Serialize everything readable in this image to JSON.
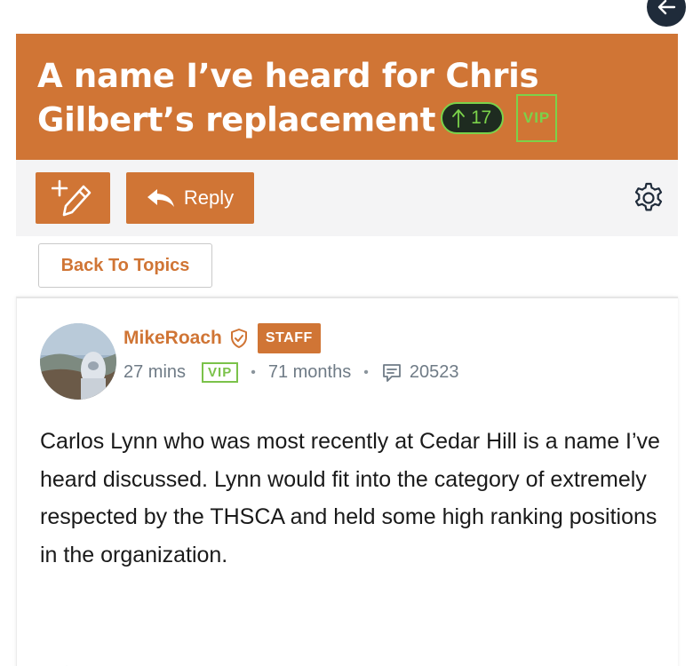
{
  "header": {
    "title": "A name I’ve heard for Chris Gilbert’s replacement",
    "vote_count": "17",
    "vip_badge": "VIP",
    "accent_color": "#d07535"
  },
  "toolbar": {
    "new_post_icon": "pencil-plus-icon",
    "reply_label": "Reply",
    "settings_icon": "gear-icon"
  },
  "navigation": {
    "back_label": "Back To Topics",
    "back_icon": "arrow-left-icon"
  },
  "post": {
    "author": "MikeRoach",
    "role_badge": "STAFF",
    "time_ago": "27 mins",
    "vip_badge": "VIP",
    "membership": "71 months",
    "post_count": "20523",
    "body": "Carlos Lynn who was most recently at Cedar Hill is a name I’ve heard discussed. Lynn would fit into the category of extremely respected by the THSCA and held some high ranking positions in the organization."
  }
}
